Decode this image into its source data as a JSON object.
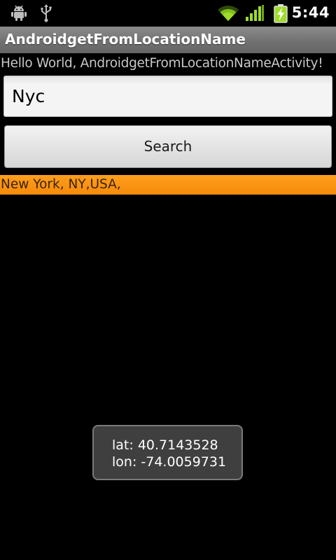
{
  "status_bar": {
    "time": "5:44",
    "icons": [
      "android-debug-icon",
      "usb-icon",
      "wifi-icon",
      "signal-icon",
      "battery-charging-icon"
    ],
    "accent": "#9fdc2a"
  },
  "app": {
    "title": "AndroidgetFromLocationName"
  },
  "main": {
    "hello_text": "Hello World, AndroidgetFromLocationNameActivity!",
    "input_value": "Nyc",
    "search_label": "Search",
    "results": [
      "New York, NY,USA,"
    ],
    "result_highlight_color": "#f7920f"
  },
  "toast": {
    "lat": "lat: 40.7143528",
    "lon": "lon: -74.0059731"
  }
}
